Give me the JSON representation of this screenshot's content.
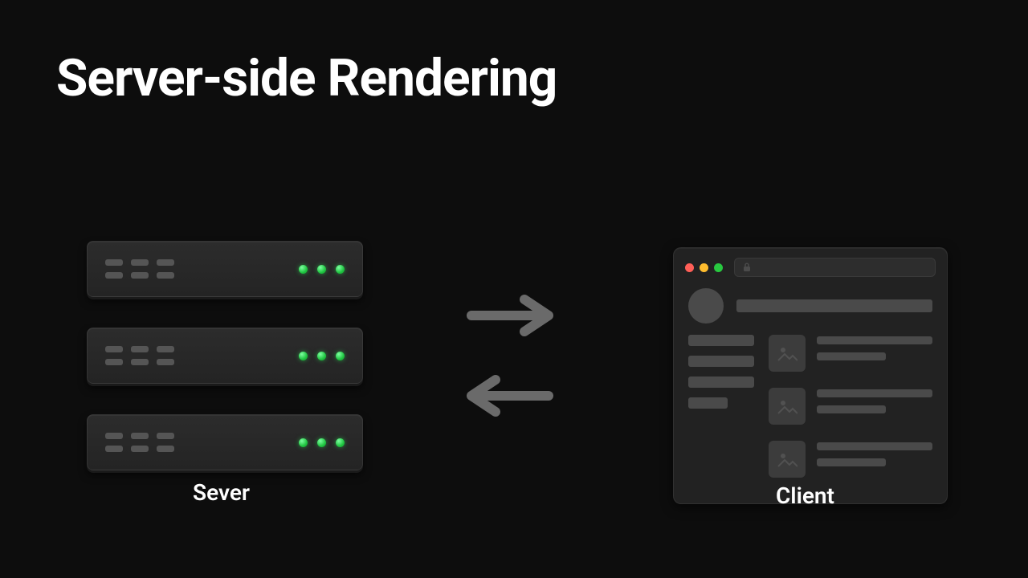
{
  "title": "Server-side Rendering",
  "labels": {
    "server": "Sever",
    "client": "Client"
  },
  "colors": {
    "led": "#1fc440",
    "traffic_red": "#ff5f57",
    "traffic_yellow": "#febc2e",
    "traffic_green": "#28c840",
    "arrow": "#6a6a6a"
  },
  "server": {
    "units": 3,
    "leds_per_unit": 3,
    "bay_cols": 3,
    "bay_rows": 2
  },
  "client": {
    "feed_cards": 3,
    "sidebar_items": 4
  }
}
